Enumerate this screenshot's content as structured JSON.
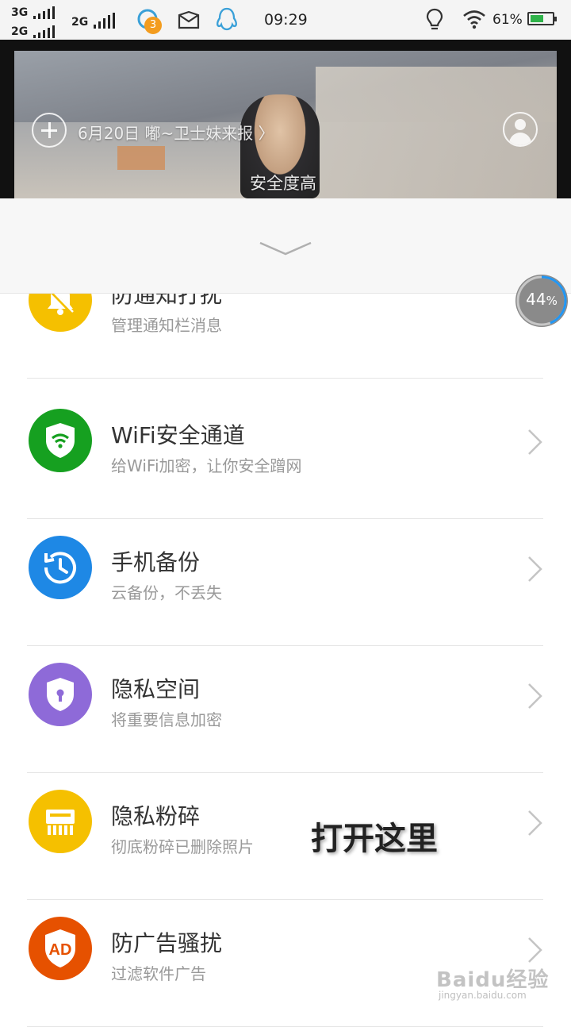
{
  "status_bar": {
    "network_1": "3G",
    "network_2": "2G",
    "network_3": "2G",
    "qq_badge": "3",
    "time": "09:29",
    "battery_text": "61%",
    "battery_level": 0.61
  },
  "banner": {
    "news_text": "6月20日 嘟~卫士妹来报 〉",
    "safety_text": "安全度高"
  },
  "progress": {
    "value": "44",
    "unit": "%",
    "fraction": 0.44
  },
  "items": [
    {
      "title": "防通知打扰",
      "subtitle": "管理通知栏消息",
      "color": "#f5c000",
      "icon": "bell-off-icon"
    },
    {
      "title": "WiFi安全通道",
      "subtitle": "给WiFi加密，让你安全蹭网",
      "color": "#16a020",
      "icon": "wifi-shield-icon"
    },
    {
      "title": "手机备份",
      "subtitle": "云备份，不丢失",
      "color": "#1e88e5",
      "icon": "backup-clock-icon"
    },
    {
      "title": "隐私空间",
      "subtitle": "将重要信息加密",
      "color": "#8e6ad8",
      "icon": "lock-shield-icon"
    },
    {
      "title": "隐私粉碎",
      "subtitle": "彻底粉碎已删除照片",
      "color": "#f5c000",
      "icon": "shredder-icon"
    },
    {
      "title": "防广告骚扰",
      "subtitle": "过滤软件广告",
      "color": "#e65100",
      "icon": "ad-shield-icon"
    }
  ],
  "annotation": "打开这里",
  "watermark": {
    "text": "Baidu经验",
    "url": "jingyan.baidu.com"
  }
}
